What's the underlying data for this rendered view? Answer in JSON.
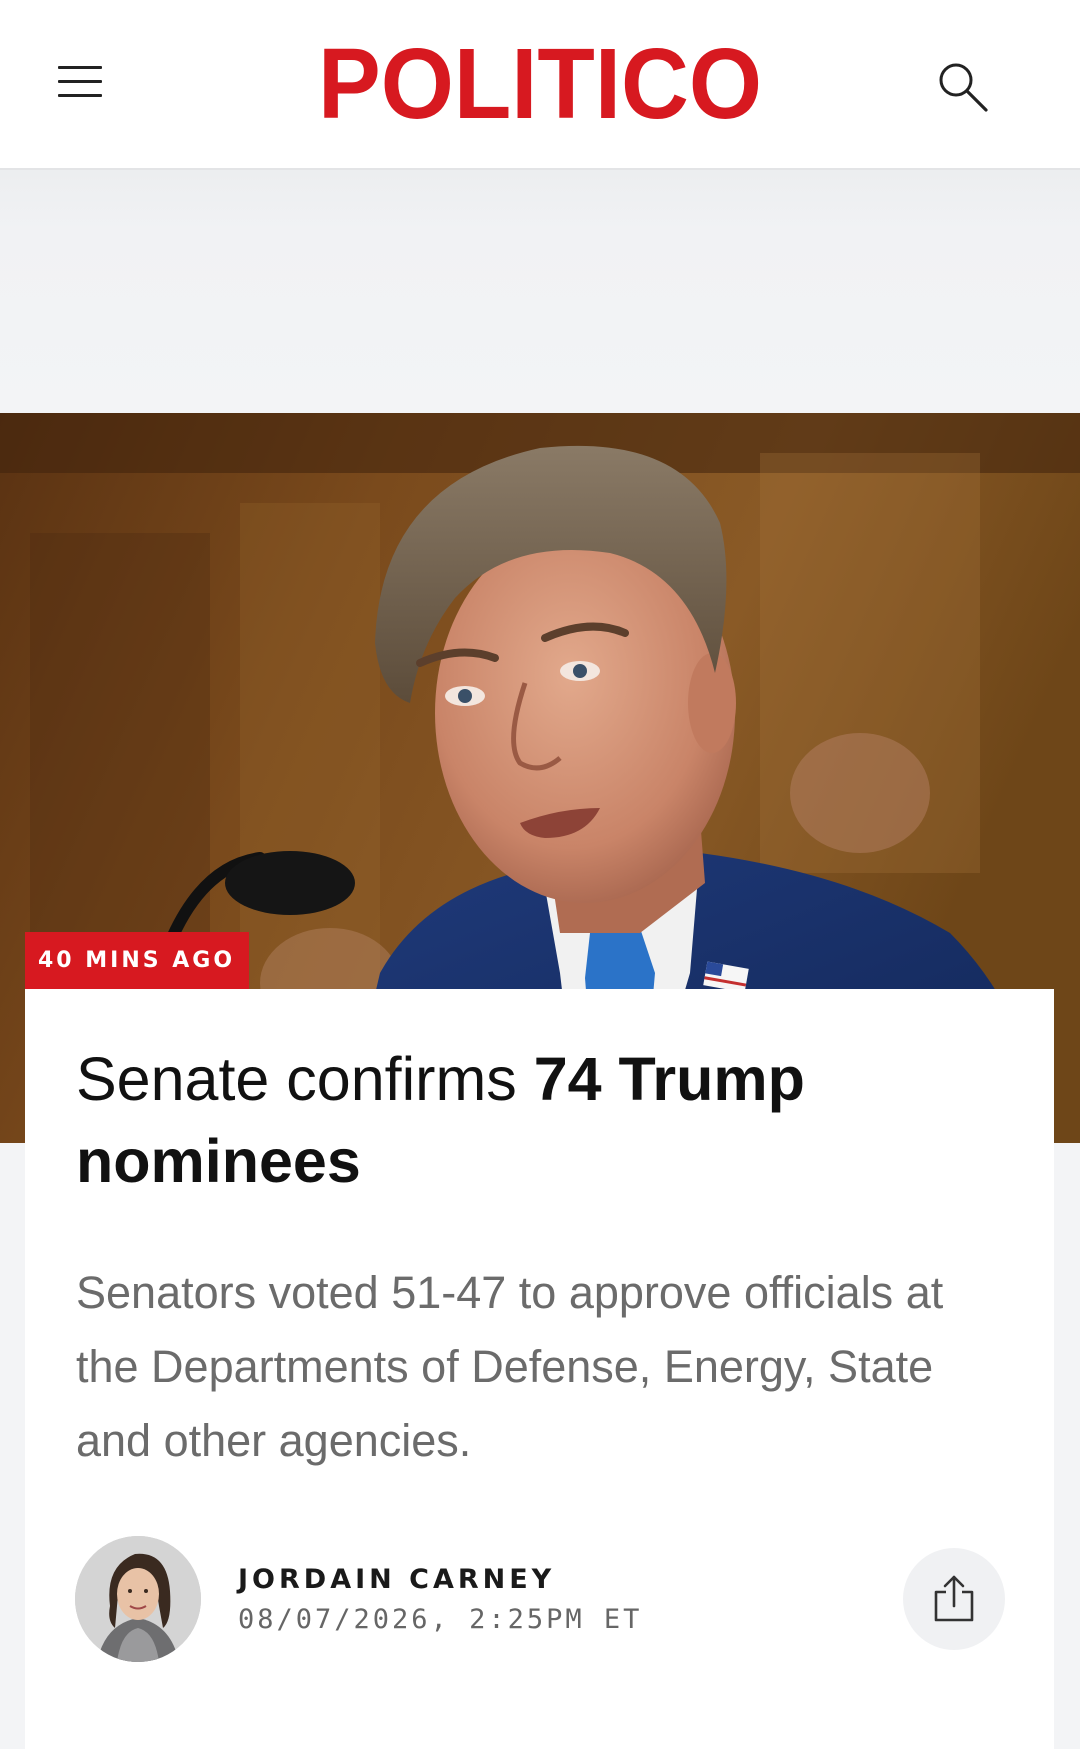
{
  "header": {
    "logo_text": "POLITICO",
    "menu_icon": "hamburger-menu-icon",
    "search_icon": "search-icon",
    "brand_color": "#d71920"
  },
  "article": {
    "timestamp_badge": "40 MINS AGO",
    "headline_regular": "Senate confirms ",
    "headline_bold": "74 Trump nominees",
    "dek": "Senators voted 51-47 to approve officials at the Departments of Defense, Energy, State and other agencies.",
    "author": "JORDAIN CARNEY",
    "date": "08/07/2026, 2:25PM ET",
    "share_icon": "share-icon"
  }
}
